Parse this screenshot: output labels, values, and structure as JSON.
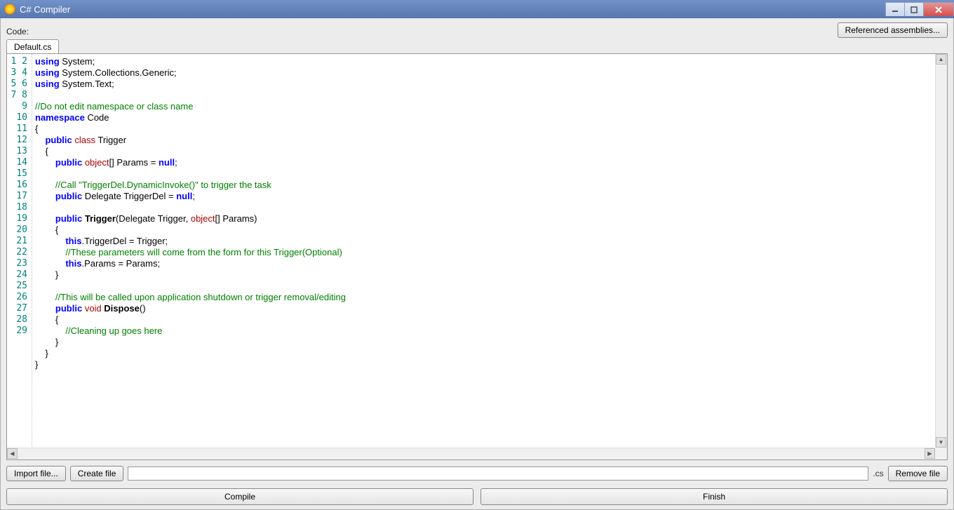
{
  "window": {
    "title": "C# Compiler"
  },
  "toolbar": {
    "code_label": "Code:",
    "ref_assemblies": "Referenced assemblies..."
  },
  "tabs": [
    {
      "label": "Default.cs"
    }
  ],
  "code": {
    "line_count": 29,
    "tokens": [
      [
        {
          "t": "using",
          "c": "kw"
        },
        {
          "t": " System;"
        }
      ],
      [
        {
          "t": "using",
          "c": "kw"
        },
        {
          "t": " System.Collections.Generic;"
        }
      ],
      [
        {
          "t": "using",
          "c": "kw"
        },
        {
          "t": " System.Text;"
        }
      ],
      [],
      [
        {
          "t": "//Do not edit namespace or class name",
          "c": "cmt"
        }
      ],
      [
        {
          "t": "namespace",
          "c": "kw"
        },
        {
          "t": " Code"
        }
      ],
      [
        {
          "t": "{"
        }
      ],
      [
        {
          "t": "    "
        },
        {
          "t": "public",
          "c": "kw"
        },
        {
          "t": " "
        },
        {
          "t": "class",
          "c": "type"
        },
        {
          "t": " Trigger"
        }
      ],
      [
        {
          "t": "    {"
        }
      ],
      [
        {
          "t": "        "
        },
        {
          "t": "public",
          "c": "kw"
        },
        {
          "t": " "
        },
        {
          "t": "object",
          "c": "type"
        },
        {
          "t": "[] Params = "
        },
        {
          "t": "null",
          "c": "kw bold"
        },
        {
          "t": ";"
        }
      ],
      [],
      [
        {
          "t": "        "
        },
        {
          "t": "//Call \"TriggerDel.DynamicInvoke()\" to trigger the task",
          "c": "cmt"
        }
      ],
      [
        {
          "t": "        "
        },
        {
          "t": "public",
          "c": "kw"
        },
        {
          "t": " Delegate TriggerDel = "
        },
        {
          "t": "null",
          "c": "kw bold"
        },
        {
          "t": ";"
        }
      ],
      [],
      [
        {
          "t": "        "
        },
        {
          "t": "public",
          "c": "kw"
        },
        {
          "t": " "
        },
        {
          "t": "Trigger",
          "c": "bold"
        },
        {
          "t": "(Delegate Trigger, "
        },
        {
          "t": "object",
          "c": "type"
        },
        {
          "t": "[] Params)"
        }
      ],
      [
        {
          "t": "        {"
        }
      ],
      [
        {
          "t": "            "
        },
        {
          "t": "this",
          "c": "kw bold"
        },
        {
          "t": ".TriggerDel = Trigger;"
        }
      ],
      [
        {
          "t": "            "
        },
        {
          "t": "//These parameters will come from the form for this Trigger(Optional)",
          "c": "cmt"
        }
      ],
      [
        {
          "t": "            "
        },
        {
          "t": "this",
          "c": "kw bold"
        },
        {
          "t": ".Params = Params;"
        }
      ],
      [
        {
          "t": "        }"
        }
      ],
      [],
      [
        {
          "t": "        "
        },
        {
          "t": "//This will be called upon application shutdown or trigger removal/editing",
          "c": "cmt"
        }
      ],
      [
        {
          "t": "        "
        },
        {
          "t": "public",
          "c": "kw"
        },
        {
          "t": " "
        },
        {
          "t": "void",
          "c": "type"
        },
        {
          "t": " "
        },
        {
          "t": "Dispose",
          "c": "bold"
        },
        {
          "t": "()"
        }
      ],
      [
        {
          "t": "        {"
        }
      ],
      [
        {
          "t": "            "
        },
        {
          "t": "//Cleaning up goes here",
          "c": "cmt"
        }
      ],
      [
        {
          "t": "        }"
        }
      ],
      [
        {
          "t": "    }"
        }
      ],
      [
        {
          "t": "}"
        }
      ],
      []
    ]
  },
  "file_row": {
    "import": "Import file...",
    "create": "Create file",
    "filename": "",
    "ext": ".cs",
    "remove": "Remove file"
  },
  "bottom": {
    "compile": "Compile",
    "finish": "Finish"
  }
}
